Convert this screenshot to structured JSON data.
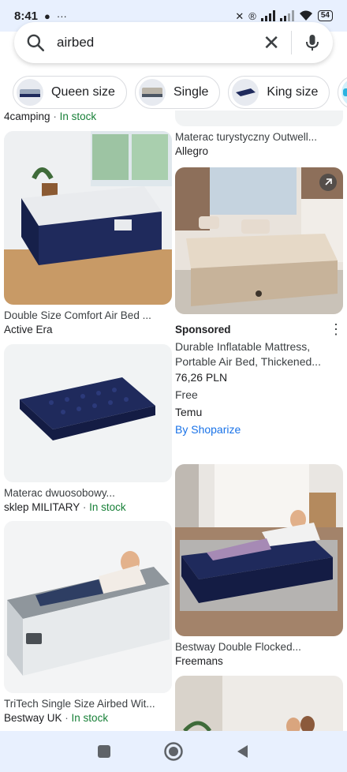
{
  "status": {
    "time": "8:41",
    "battery": "54"
  },
  "search": {
    "query": "airbed",
    "icon": "search-icon",
    "clear_icon": "close-icon",
    "mic_icon": "mic-icon"
  },
  "chips": [
    {
      "label": "Queen size"
    },
    {
      "label": "Single"
    },
    {
      "label": "King size"
    },
    {
      "label": ""
    }
  ],
  "results": {
    "left": [
      {
        "title": "",
        "source": "4camping",
        "stock": "In stock"
      },
      {
        "title": "Double Size Comfort Air Bed ...",
        "source": "Active Era",
        "stock": ""
      },
      {
        "title": "Materac dwuosobowy...",
        "source": "sklep MILITARY",
        "stock": "In stock"
      },
      {
        "title": "TriTech Single Size Airbed Wit...",
        "source": "Bestway UK",
        "stock": "In stock"
      }
    ],
    "right": [
      {
        "title": "Materac turystyczny Outwell...",
        "source": "Allegro"
      },
      {
        "sponsored": "Sponsored",
        "title": "Durable Inflatable Mattress, Portable Air Bed, Thickened...",
        "price": "76,26 PLN",
        "shipping": "Free",
        "merchant": "Temu",
        "by": "By Shoparize"
      },
      {
        "title": "Bestway Double Flocked...",
        "source": "Freemans"
      }
    ]
  },
  "colors": {
    "accent_blue": "#1a73e8",
    "in_stock_green": "#188038",
    "navy_mattress": "#1f2a5c"
  }
}
